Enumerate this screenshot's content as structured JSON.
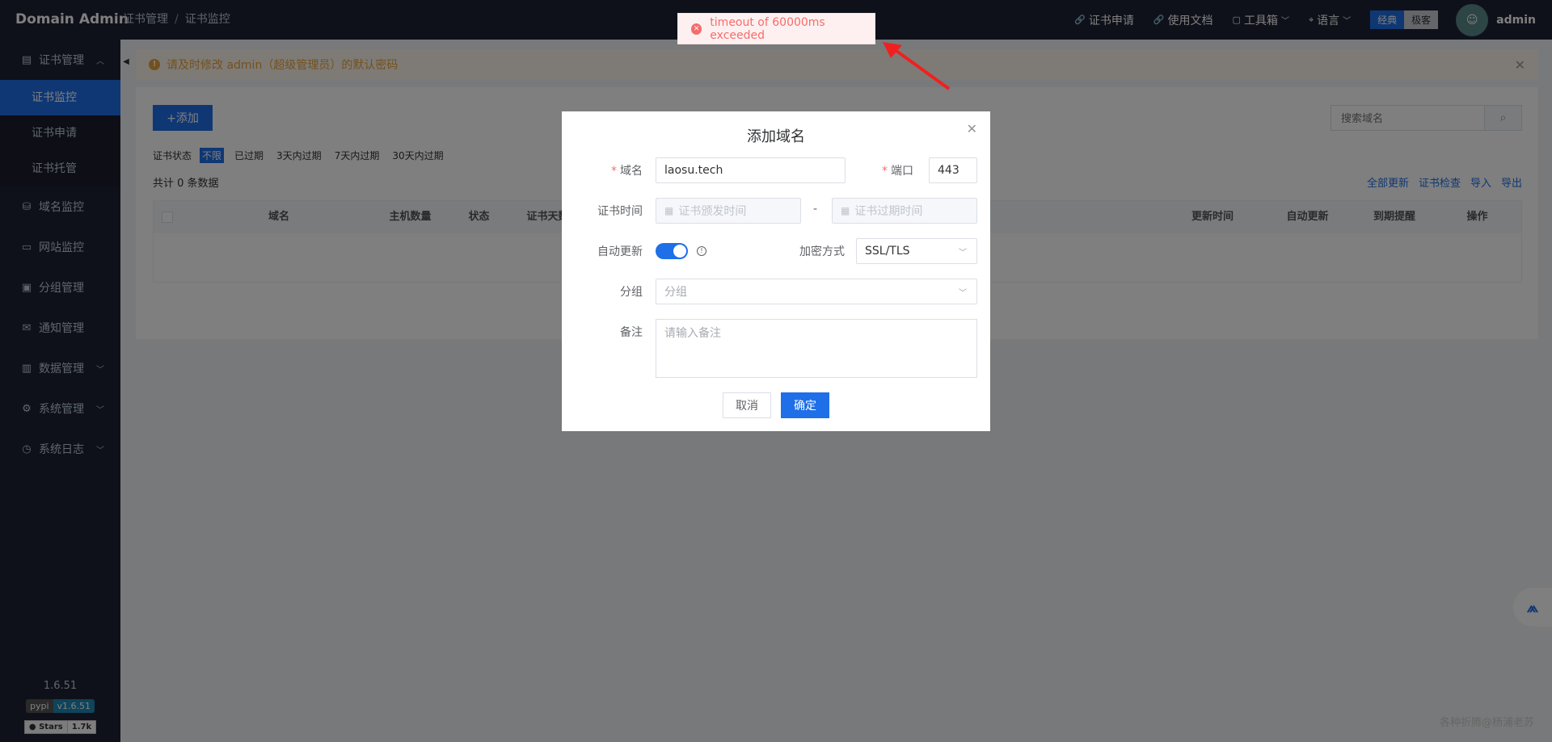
{
  "app": {
    "title": "Domain Admin"
  },
  "breadcrumb": [
    "证书管理",
    "证书监控"
  ],
  "header": {
    "links": [
      "证书申请",
      "使用文档",
      "工具箱",
      "语言"
    ],
    "modes": [
      "经典",
      "极客"
    ],
    "user": "admin"
  },
  "sidebar": {
    "groups": [
      {
        "label": "证书管理",
        "icon": "document-icon"
      },
      {
        "label": "域名监控",
        "icon": "database-icon"
      },
      {
        "label": "网站监控",
        "icon": "monitor-icon"
      },
      {
        "label": "分组管理",
        "icon": "folder-icon"
      },
      {
        "label": "通知管理",
        "icon": "mail-icon"
      },
      {
        "label": "数据管理",
        "icon": "briefcase-icon"
      },
      {
        "label": "系统管理",
        "icon": "gear-icon"
      },
      {
        "label": "系统日志",
        "icon": "clock-icon"
      }
    ],
    "sub_items": [
      "证书监控",
      "证书申请",
      "证书托管"
    ],
    "version": "1.6.51",
    "pypi": {
      "left": "pypi",
      "right": "v1.6.51"
    },
    "github": {
      "left": "Stars",
      "right": "1.7k"
    }
  },
  "alert": {
    "text": "请及时修改 admin（超级管理员）的默认密码"
  },
  "toolbar": {
    "add_label": "+添加",
    "search_placeholder": "搜索域名"
  },
  "filters": {
    "label": "证书状态",
    "options": [
      "不限",
      "已过期",
      "3天内过期",
      "7天内过期",
      "30天内过期"
    ]
  },
  "total": "共计 0 条数据",
  "actions": [
    "全部更新",
    "证书检查",
    "导入",
    "导出"
  ],
  "table": {
    "columns": [
      "域名",
      "主机数量",
      "状态",
      "证书天数",
      "更新时间",
      "自动更新",
      "到期提醒",
      "操作"
    ]
  },
  "modal": {
    "title": "添加域名",
    "domain_label": "域名",
    "domain_value": "laosu.tech",
    "port_label": "端口",
    "port_value": "443",
    "cert_time_label": "证书时间",
    "start_placeholder": "证书颁发时间",
    "end_placeholder": "证书过期时间",
    "range_sep": "-",
    "auto_update_label": "自动更新",
    "encrypt_label": "加密方式",
    "encrypt_value": "SSL/TLS",
    "group_label": "分组",
    "group_placeholder": "分组",
    "remark_label": "备注",
    "remark_placeholder": "请输入备注",
    "cancel": "取消",
    "confirm": "确定"
  },
  "toast": {
    "text": "timeout of 60000ms exceeded"
  },
  "watermark": "各种折腾@杨浦老苏",
  "colors": {
    "primary": "#1e6fe8",
    "sidebar": "#1f2235",
    "error": "#f56c6c",
    "warning": "#e6a23c"
  }
}
